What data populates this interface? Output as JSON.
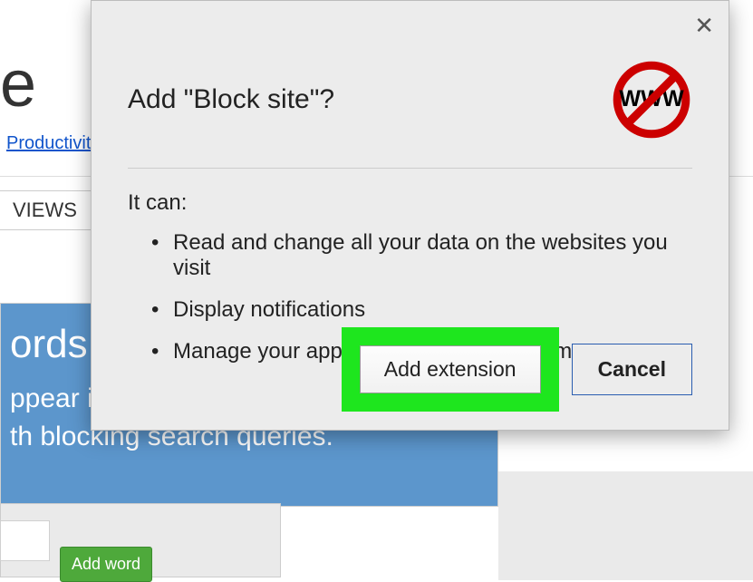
{
  "background": {
    "title_fragment": "e",
    "link_text": "Productivit",
    "tab_label": "VIEWS",
    "hero_line1": "ords",
    "hero_line2a": "ppear i",
    "hero_line2b": "th blocking search queries.",
    "add_word_button": "Add word"
  },
  "dialog": {
    "title": "Add \"Block site\"?",
    "icon_text": "WWW",
    "permissions_label": "It can:",
    "permissions": [
      "Read and change all your data on the websites you visit",
      "Display notifications",
      "Manage your apps, extensions, and themes"
    ],
    "add_button_label": "Add extension",
    "cancel_button_label": "Cancel"
  }
}
